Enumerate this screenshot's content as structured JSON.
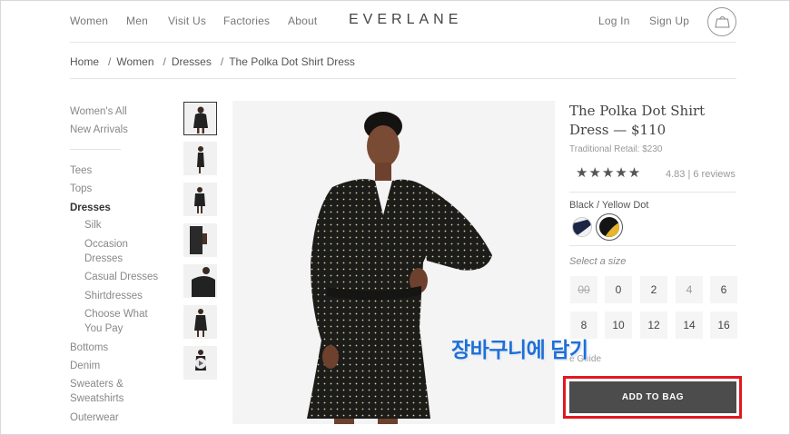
{
  "nav": {
    "left": [
      "Women",
      "Men",
      "Visit Us",
      "Factories",
      "About"
    ],
    "logo": "EVERLANE",
    "right": [
      "Log In",
      "Sign Up"
    ],
    "cart_icon": "bag-icon"
  },
  "breadcrumb": [
    "Home",
    "Women",
    "Dresses",
    "The Polka Dot Shirt Dress"
  ],
  "breadcrumb_separator": "/",
  "sidebar": {
    "top": [
      "Women's All",
      "New Arrivals"
    ],
    "categories": [
      "Tees",
      "Tops",
      "Dresses"
    ],
    "active": "Dresses",
    "subcategories": [
      "Silk",
      "Occasion",
      "Dresses",
      "Casual Dresses",
      "Shirtdresses",
      "Choose What",
      "You Pay"
    ],
    "more": [
      "Bottoms",
      "Denim",
      "Sweaters &",
      "Sweatshirts",
      "Outerwear"
    ]
  },
  "product": {
    "title_line1": "The Polka Dot Shirt",
    "title_line2": "Dress — $110",
    "traditional_retail": "Traditional Retail: $230",
    "stars": "★★★★★",
    "rating": "4.83 | 6 reviews",
    "color_name": "Black / Yellow Dot",
    "size_prompt": "Select a size",
    "sizes": [
      "00",
      "0",
      "2",
      "4",
      "6",
      "8",
      "10",
      "12",
      "14",
      "16"
    ],
    "size_guide": "e Guide",
    "add_to_bag": "ADD TO BAG"
  },
  "annotation": {
    "text": "장바구니에 담기",
    "highlight_color": "#e0191f",
    "text_color": "#1f6fd6"
  }
}
